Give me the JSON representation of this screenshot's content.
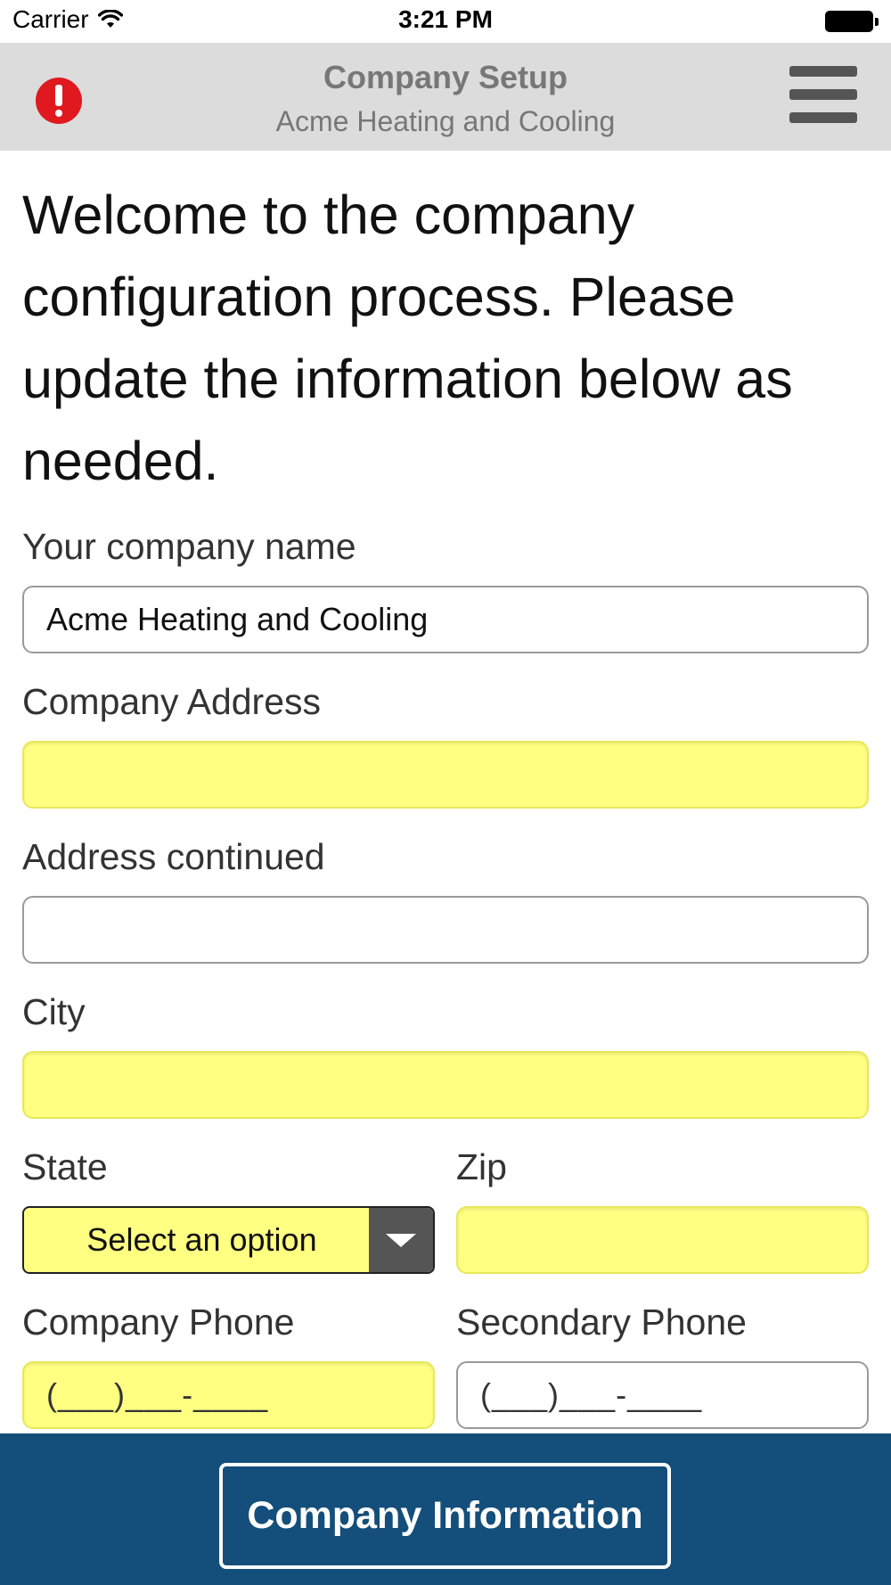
{
  "status_bar": {
    "carrier": "Carrier",
    "time": "3:21 PM"
  },
  "header": {
    "title": "Company Setup",
    "subtitle": "Acme Heating and Cooling",
    "alert_icon": "exclamation-circle-icon",
    "menu_icon": "hamburger-menu-icon",
    "alert_color": "#e0191f"
  },
  "welcome_text": "Welcome to the company configuration process. Please update the information below as needed.",
  "form": {
    "company_name": {
      "label": "Your company name",
      "value": "Acme Heating and Cooling"
    },
    "address": {
      "label": "Company Address",
      "value": "",
      "required": true
    },
    "address2": {
      "label": "Address continued",
      "value": ""
    },
    "city": {
      "label": "City",
      "value": "",
      "required": true
    },
    "state": {
      "label": "State",
      "value": "Select an option",
      "required": true
    },
    "zip": {
      "label": "Zip",
      "value": "",
      "required": true
    },
    "phone": {
      "label": "Company Phone",
      "value": "(___)___-____",
      "required": true
    },
    "phone2": {
      "label": "Secondary Phone",
      "value": "(___)___-____"
    }
  },
  "footer": {
    "button_label": "Company Information",
    "background": "#144e7a"
  },
  "colors": {
    "required_field": "#ffff82",
    "header_bg": "#dcdcdc"
  }
}
